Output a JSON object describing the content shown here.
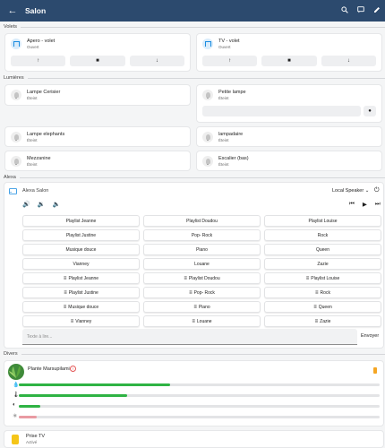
{
  "header": {
    "title": "Salon",
    "back_icon": "arrow-left-icon",
    "icons": [
      "search-icon",
      "message-icon",
      "pencil-icon"
    ]
  },
  "sections": {
    "volets": "Volets",
    "lumieres": "Lumières",
    "alexa": "Alexa",
    "divers": "Divers"
  },
  "covers": [
    {
      "name": "Apero - volet",
      "state": "Ouvert"
    },
    {
      "name": "TV - volet",
      "state": "Ouvert"
    }
  ],
  "lights": [
    {
      "name": "Lampe Cerisier",
      "state": "Éteint"
    },
    {
      "name": "Petite lampe",
      "state": "Éteint"
    },
    {
      "name": "Lampe elephants",
      "state": "Éteint"
    },
    {
      "name": "lampadaire",
      "state": "Éteint"
    },
    {
      "name": "Mezzanine",
      "state": "Éteint"
    },
    {
      "name": "Escalier (bas)",
      "state": "Éteint"
    }
  ],
  "alexa": {
    "device": "Alexa Salon",
    "source": "Local Speaker",
    "text_placeholder": "Texte à lire...",
    "send_label": "Envoyer",
    "rows": [
      [
        "Playlist Jeanne",
        "Playlist Doudou",
        "Playlist Louise"
      ],
      [
        "Playlist Justine",
        "Pop- Rock",
        "Rock"
      ],
      [
        "Musique douce",
        "Piano",
        "Queen"
      ],
      [
        "Vianney",
        "Louane",
        "Zazie"
      ],
      [
        "Playlist Jeanne",
        "Playlist Doudou",
        "Playlist Louise"
      ],
      [
        "Playlist Justine",
        "Pop- Rock",
        "Rock"
      ],
      [
        "Musique douce",
        "Piano",
        "Queen"
      ],
      [
        "Vianney",
        "Louane",
        "Zazie"
      ]
    ]
  },
  "plant": {
    "name": "Plante Marsupilami",
    "sensors": [
      {
        "icon": "water-drop-icon",
        "level": 0.42
      },
      {
        "icon": "thermometer-icon",
        "level": 0.3
      },
      {
        "icon": "brightness-icon",
        "level": 0.06
      },
      {
        "icon": "fertilizer-icon",
        "level": 0.05
      }
    ]
  },
  "divers": [
    {
      "name": "Prise TV",
      "state": "Activé"
    }
  ],
  "colors": {
    "header": "#2c4a6e",
    "accent": "#1a8ce0",
    "bar_green": "#2fb344",
    "bar_pink": "#e99aa2",
    "battery": "#f5a623"
  }
}
